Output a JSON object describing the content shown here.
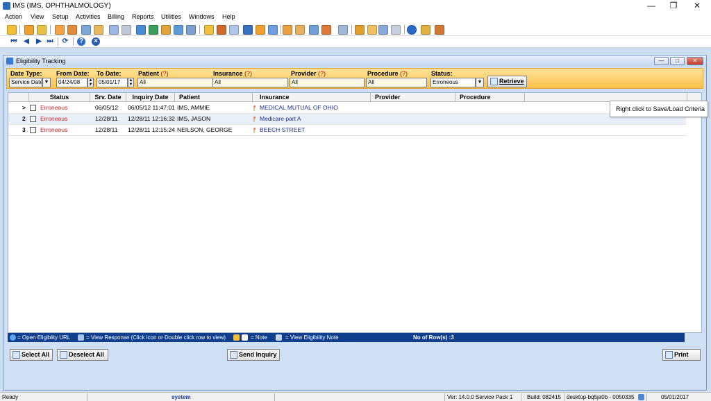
{
  "window": {
    "title": "IMS (IMS, OPHTHALMOLOGY)"
  },
  "menu": [
    "Action",
    "View",
    "Setup",
    "Activities",
    "Billing",
    "Reports",
    "Utilities",
    "Windows",
    "Help"
  ],
  "child": {
    "title": "Eligibility Tracking"
  },
  "criteria": {
    "date_type_label": "Date Type:",
    "date_type_value": "Service Date",
    "from_label": "From Date:",
    "from_value": "04/24/08",
    "to_label": "To Date:",
    "to_value": "05/01/17",
    "patient_label": "Patient",
    "insurance_label": "Insurance",
    "provider_label": "Provider",
    "procedure_label": "Procedure",
    "q": "(?)",
    "patient_value": "All",
    "insurance_value": "All",
    "provider_value": "All",
    "procedure_value": "All",
    "status_label": "Status:",
    "status_value": "Erroneous",
    "retrieve_label": "Retrieve"
  },
  "grid": {
    "columns": [
      "Status",
      "Srv. Date",
      "Inquiry Date",
      "Patient",
      "Insurance",
      "Provider",
      "Procedure"
    ],
    "rows": [
      {
        "marker": ">",
        "status": "Erroneous",
        "srv_date": "06/05/12",
        "inquiry_date": "06/05/12 11:47:01",
        "patient": "IMS, AMMIE",
        "insurance": "MEDICAL MUTUAL OF OHIO",
        "provider": "",
        "procedure": ""
      },
      {
        "marker": "2",
        "status": "Erroneous",
        "srv_date": "12/28/11",
        "inquiry_date": "12/28/11 12:16:32",
        "patient": "IMS, JASON",
        "insurance": "Medicare part A",
        "provider": "",
        "procedure": ""
      },
      {
        "marker": "3",
        "status": "Erroneous",
        "srv_date": "12/28/11",
        "inquiry_date": "12/28/11 12:15:24",
        "patient": "NEILSON, GEORGE",
        "insurance": "BEECH STREET",
        "provider": "",
        "procedure": ""
      }
    ]
  },
  "tooltip": "Right click to Save/Load Criteria",
  "legend": {
    "url": "= Open Eligiblity URL",
    "response": "= View Response (Click icon or Double click row to view)",
    "note": "= Note",
    "elig_note": "= View Eligibility Note",
    "rows": "No of Row(s) :3"
  },
  "buttons": {
    "select_all": "Select All",
    "deselect_all": "Deselect All",
    "send_inquiry": "Send Inquiry",
    "print": "Print"
  },
  "statusbar": {
    "ready": "Ready",
    "user": "system",
    "version": "Ver: 14.0.0 Service Pack 1",
    "build": "Build: 082415",
    "machine": "desktop-bq5ja0b - 0050335",
    "date": "05/01/2017"
  },
  "colors": {
    "error_status": "#e01a1a",
    "criteria_bg": "#f9c14a",
    "legend_bg": "#0f3f8c"
  }
}
